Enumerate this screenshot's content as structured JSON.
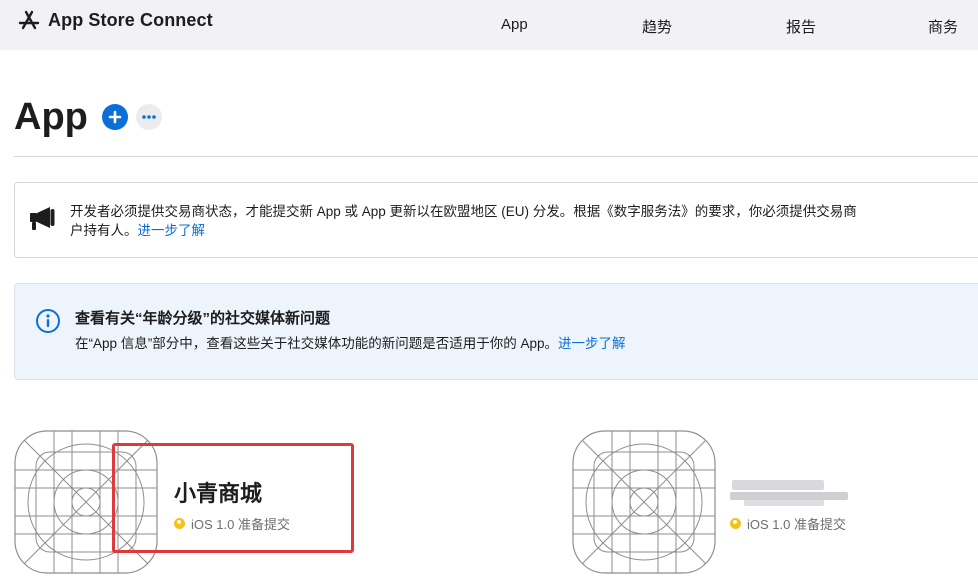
{
  "topbar": {
    "brand": "App Store Connect",
    "nav": [
      "App",
      "趋势",
      "报告",
      "商务"
    ]
  },
  "page": {
    "title": "App"
  },
  "eu_banner": {
    "line1": "开发者必须提供交易商状态，才能提交新 App 或 App 更新以在欧盟地区 (EU) 分发。根据《数字服务法》的要求，你必须提供交易商",
    "line2": "户持有人。",
    "link": "进一步了解"
  },
  "info_banner": {
    "title": "查看有关“年龄分级”的社交媒体新问题",
    "body": "在“App 信息”部分中，查看这些关于社交媒体功能的新问题是否适用于你的 App。",
    "link": "进一步了解"
  },
  "apps": [
    {
      "name": "小青商城",
      "status": "iOS 1.0 准备提交"
    },
    {
      "name": "",
      "status": "iOS 1.0 准备提交"
    }
  ],
  "colors": {
    "accent": "#0a6fd6",
    "status_dot": "#f3c318",
    "highlight": "#e0393b"
  }
}
